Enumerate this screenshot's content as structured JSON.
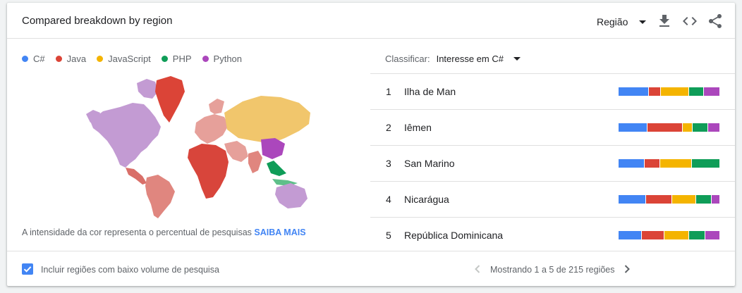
{
  "header": {
    "title": "Compared breakdown by region",
    "region_label": "Região",
    "icons": [
      "download-icon",
      "embed-code-icon",
      "share-icon"
    ]
  },
  "legend": [
    {
      "label": "C#",
      "color": "#4285f4"
    },
    {
      "label": "Java",
      "color": "#db4437"
    },
    {
      "label": "JavaScript",
      "color": "#f4b400"
    },
    {
      "label": "PHP",
      "color": "#0f9d58"
    },
    {
      "label": "Python",
      "color": "#ab47bc"
    }
  ],
  "map": {
    "note": "A intensidade da cor representa o percentual de pesquisas",
    "learn_more": "SAIBA MAIS"
  },
  "sort": {
    "label": "Classificar:",
    "value": "Interesse em C#"
  },
  "regions": [
    {
      "rank": "1",
      "name": "Ilha de Man",
      "shares": [
        30,
        12,
        28,
        14,
        16
      ]
    },
    {
      "rank": "2",
      "name": "Iêmen",
      "shares": [
        28,
        35,
        9,
        15,
        11
      ]
    },
    {
      "rank": "3",
      "name": "San Marino",
      "shares": [
        26,
        15,
        31,
        28,
        0
      ]
    },
    {
      "rank": "4",
      "name": "Nicarágua",
      "shares": [
        27,
        26,
        24,
        15,
        8
      ]
    },
    {
      "rank": "5",
      "name": "República Dominicana",
      "shares": [
        23,
        22,
        24,
        16,
        14
      ]
    }
  ],
  "footer": {
    "include_low_volume_label": "Incluir regiões com baixo volume de pesquisa",
    "include_low_volume_checked": true,
    "pagination_text": "Mostrando 1 a 5 de 215 regiões"
  }
}
